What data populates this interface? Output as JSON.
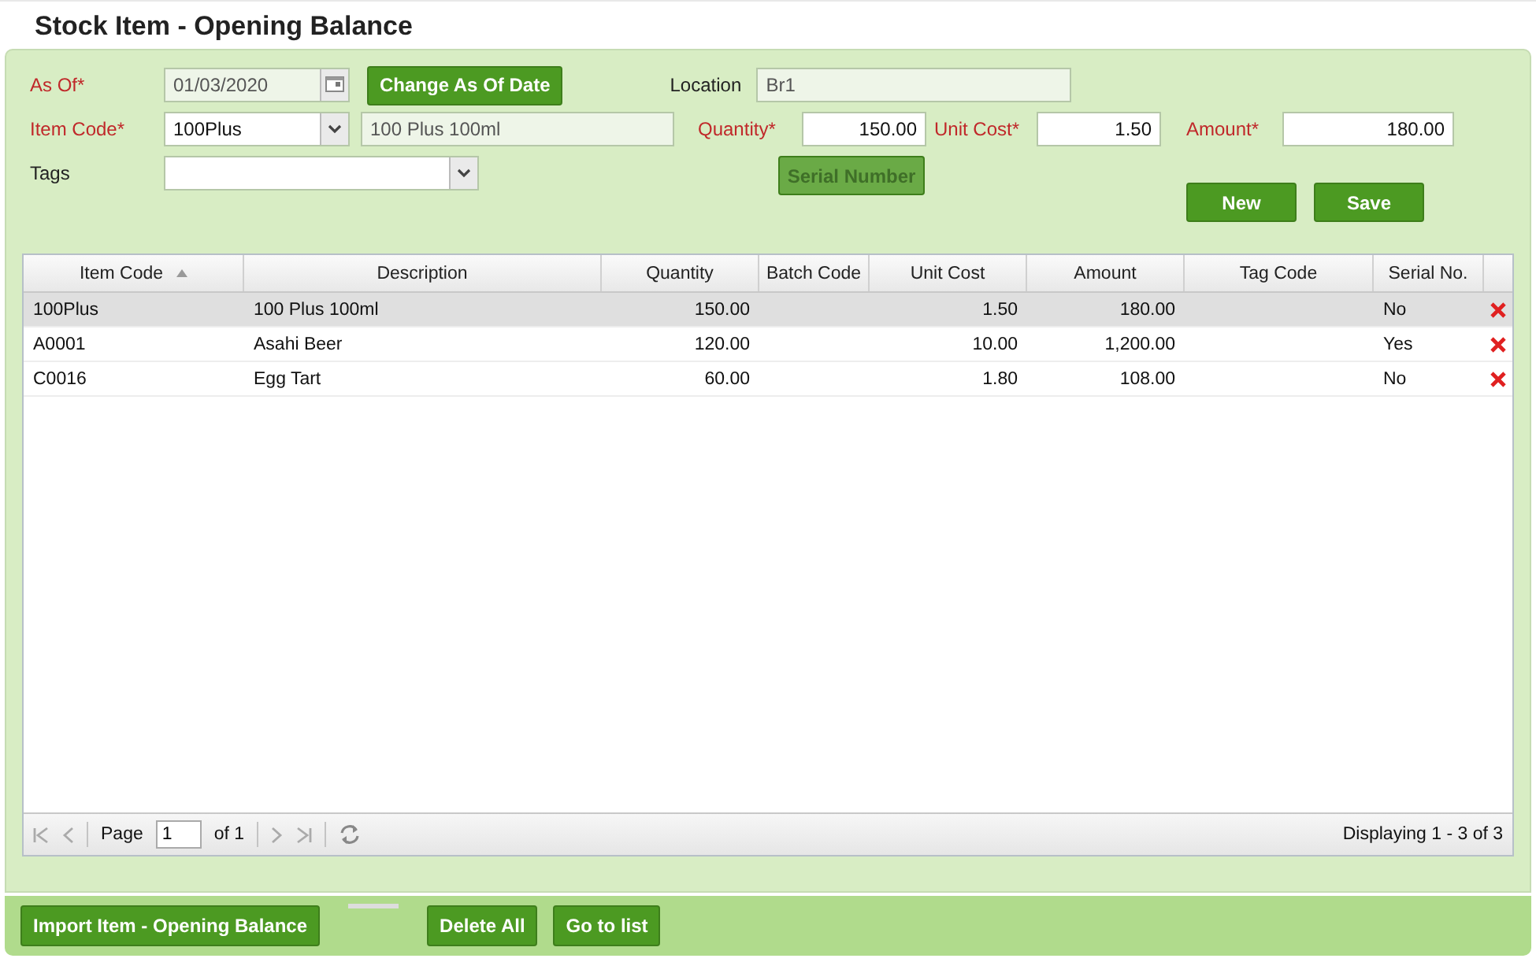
{
  "window": {
    "title": "Stock Item - Opening Balance"
  },
  "form": {
    "as_of": {
      "label": "As Of*",
      "required": true,
      "value": "01/03/2020",
      "disabled": true
    },
    "change_date_button": {
      "label": "Change As Of Date",
      "disabled": false
    },
    "location": {
      "label": "Location",
      "required": false,
      "value": "Br1",
      "disabled": true
    },
    "item_code": {
      "label": "Item Code*",
      "required": true,
      "value": "100Plus",
      "description": "100 Plus 100ml"
    },
    "quantity": {
      "label": "Quantity*",
      "required": true,
      "value": "150.00"
    },
    "unit_cost": {
      "label": "Unit Cost*",
      "required": true,
      "value": "1.50"
    },
    "amount": {
      "label": "Amount*",
      "required": true,
      "value": "180.00"
    },
    "tags": {
      "label": "Tags",
      "required": false
    },
    "serial_button": {
      "label": "Serial Number",
      "disabled": true
    },
    "buttons": [
      {
        "label": "New",
        "disabled": false
      },
      {
        "label": "Save",
        "disabled": false
      }
    ]
  },
  "table": {
    "columns": [
      {
        "label": "Item Code",
        "sorted": true
      },
      {
        "label": "Description",
        "sorted": false
      },
      {
        "label": "Quantity",
        "sorted": false
      },
      {
        "label": "Batch Code",
        "sorted": false
      },
      {
        "label": "Unit Cost",
        "sorted": false
      },
      {
        "label": "Amount",
        "sorted": false
      },
      {
        "label": "Tag Code",
        "sorted": false
      },
      {
        "label": "Serial No.",
        "sorted": false
      }
    ],
    "rows": [
      {
        "selected": true,
        "cells": [
          "100Plus",
          "100 Plus 100ml",
          "150.00",
          "",
          "1.50",
          "180.00",
          "",
          "No"
        ]
      },
      {
        "selected": false,
        "cells": [
          "A0001",
          "Asahi Beer",
          "120.00",
          "",
          "10.00",
          "1,200.00",
          "",
          "Yes"
        ]
      },
      {
        "selected": false,
        "cells": [
          "C0016",
          "Egg Tart",
          "60.00",
          "",
          "1.80",
          "108.00",
          "",
          "No"
        ]
      }
    ]
  },
  "pager": {
    "page_label": "Page",
    "page": "1",
    "of_label": "of 1",
    "display": "Displaying 1 - 3 of 3"
  },
  "footer_buttons": [
    {
      "label": "Import Item - Opening Balance"
    },
    {
      "label": "Delete All"
    },
    {
      "label": "Go to list"
    }
  ]
}
